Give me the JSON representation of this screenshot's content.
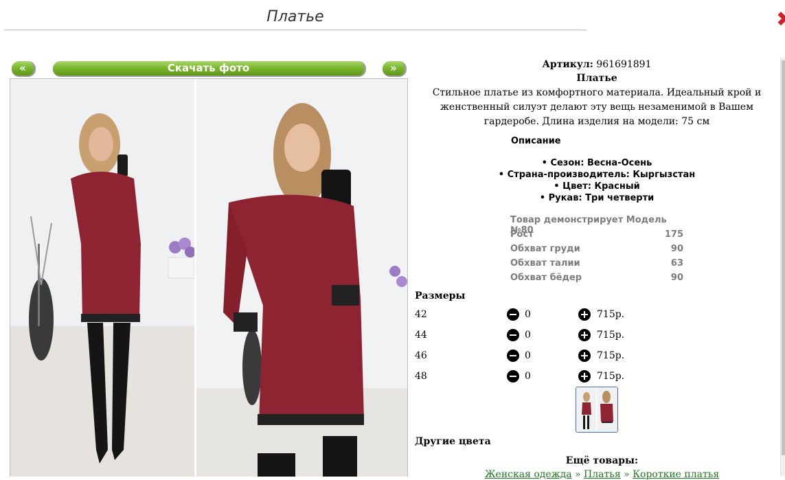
{
  "page": {
    "title": "Платье"
  },
  "photo_nav": {
    "prev": "«",
    "download": "Скачать фото",
    "next": "»"
  },
  "product": {
    "article_label": "Артикул:",
    "article_value": "961691891",
    "name": "Платье",
    "description": "Стильное платье из комфортного материала. Идеальный крой и женственный силуэт делают эту вещь незаменимой в Вашем гардеробе. Длина изделия на модели: 75 см"
  },
  "specs": {
    "heading": "Описание",
    "items": [
      "Сезон: Весна-Осень",
      "Страна-производитель: Кыргызстан",
      "Цвет: Красный",
      "Рукав: Три четверти"
    ]
  },
  "model": {
    "heading": "Товар демонстрирует Модель №80",
    "rows": [
      {
        "label": "Рост",
        "value": "175"
      },
      {
        "label": "Обхват груди",
        "value": "90"
      },
      {
        "label": "Обхват талии",
        "value": "63"
      },
      {
        "label": "Обхват бёдер",
        "value": "90"
      }
    ]
  },
  "sizes": {
    "heading": "Размеры",
    "rows": [
      {
        "size": "42",
        "qty": "0",
        "price": "715р."
      },
      {
        "size": "44",
        "qty": "0",
        "price": "715р."
      },
      {
        "size": "46",
        "qty": "0",
        "price": "715р."
      },
      {
        "size": "48",
        "qty": "0",
        "price": "715р."
      }
    ]
  },
  "other_colors": "Другие цвета",
  "more_products": "Ещё товары:",
  "breadcrumb": [
    "Женская одежда",
    "Платья",
    "Короткие платья"
  ],
  "breadcrumb_sep": "»",
  "colors": {
    "accent_green": "#79b52c",
    "link_green": "#1f7a1f",
    "dress_red": "#8e2431",
    "close_red": "#d21f26"
  }
}
